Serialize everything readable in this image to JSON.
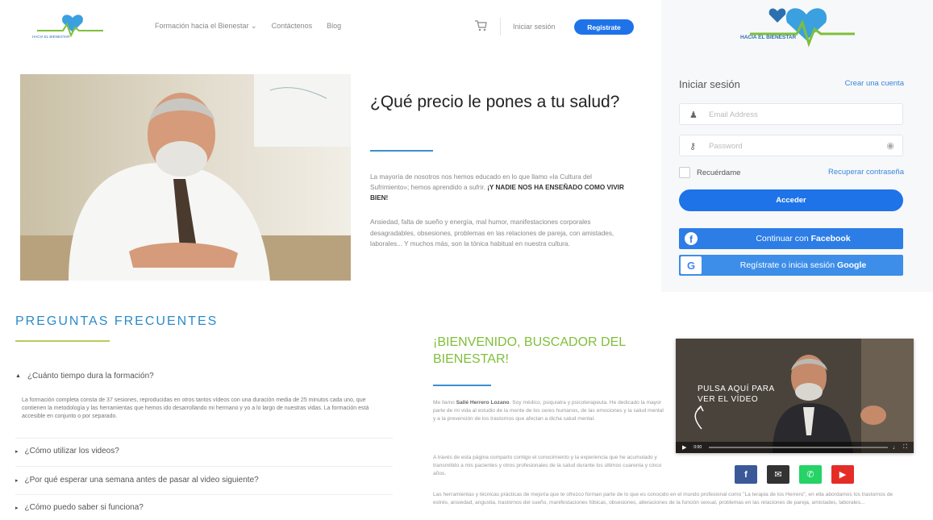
{
  "nav": {
    "logo_text": "HACIA EL BIENESTAR",
    "links": [
      "Formación hacia el Bienestar ⌄",
      "Contáctenos",
      "Blog"
    ],
    "login": "Iniciar sesión",
    "signup": "Regístrate"
  },
  "hero": {
    "title": "¿Qué precio le pones a tu salud?",
    "p1_text": "La mayoría de nosotros nos hemos educado en lo que llamo «la Cultura del Sufrimiento»; hemos aprendido a sufrir.",
    "p1_bold": "¡Y NADIE NOS HA ENSEÑADO COMO VIVIR BIEN!",
    "p2": "Ansiedad, falta de sueño y energía, mal humor, manifestaciones corporales desagradables, obsesiones, problemas en las relaciones de pareja, con amistades, laborales... Y muchos más, son la tónica habitual en nuestra cultura."
  },
  "login": {
    "logo_text": "HACIA EL BIENESTAR",
    "title": "Iniciar sesión",
    "create_account": "Crear una cuenta",
    "email_placeholder": "Email Address",
    "password_placeholder": "Password",
    "remember": "Recuérdame",
    "forgot": "Recuperar contraseña",
    "submit": "Acceder",
    "facebook_prefix": "Continuar con ",
    "facebook_bold": "Facebook",
    "google_prefix": "Regístrate o inicia sesión ",
    "google_bold": "Google"
  },
  "faq": {
    "title": "PREGUNTAS FRECUENTES",
    "items": [
      {
        "question": "¿Cuánto tiempo dura la formación?",
        "answer": "La formación completa consta de 37 sesiones, reproducidas en otros tantos vídeos con una duración media de 25 minutos cada uno, que contienen la metodología y las herramientas que hemos ido desarrollando mi hermano y yo a lo largo de nuestras vidas. La formación está accesible en conjunto o por separado."
      },
      {
        "question": "¿Cómo utilizar los videos?"
      },
      {
        "question": "¿Por qué esperar una semana antes de pasar al video siguiente?"
      },
      {
        "question": "¿Cómo puedo saber si funciona?"
      }
    ]
  },
  "welcome": {
    "title": "¡BIENVENIDO, BUSCADOR DEL BIENESTAR!",
    "p1_prefix": "Me llamo ",
    "p1_name": "Sallé Herrero Lozano",
    "p1_rest": ". Soy médico, psiquiatra y psicoterapeuta. He dedicado la mayor parte de mi vida al estudio de la mente de los seres humanos, de las emociones y la salud mental y a la prevención de los trastornos que afectan a dicha salud mental.",
    "p2": "A través de esta página comparto contigo el conocimiento y la experiencia que he acumulado y transmitido a mis pacientes y otros profesionales de la salud durante los últimos cuarenta y cinco años.",
    "p3": "Las herramientas y técnicas prácticas de mejoría que te ofrezco forman parte de lo que es conocido en el mundo profesional como \"La terapia de los Herrero\", en ella abordamos los trastornos de estrés, ansiedad, angustia, trastornos del sueño, manifestaciones fóbicas, obsesiones, alteraciones de la función sexual, problemas en las relaciones de pareja, amistades, laborales..."
  },
  "video": {
    "caption_line1": "PULSA AQUÍ PARA",
    "caption_line2": "VER EL VÍDEO",
    "time": "0:00"
  },
  "colors": {
    "brand_blue": "#1e73e8",
    "faq_blue": "#2b8ac9",
    "welcome_green": "#7fbf3a",
    "facebook": "#2d7de6"
  },
  "icons": [
    "cart-icon",
    "user-icon",
    "key-icon",
    "eye-icon",
    "facebook-icon",
    "google-icon",
    "play-icon",
    "share-facebook-icon",
    "share-email-icon",
    "share-whatsapp-icon",
    "share-youtube-icon"
  ]
}
